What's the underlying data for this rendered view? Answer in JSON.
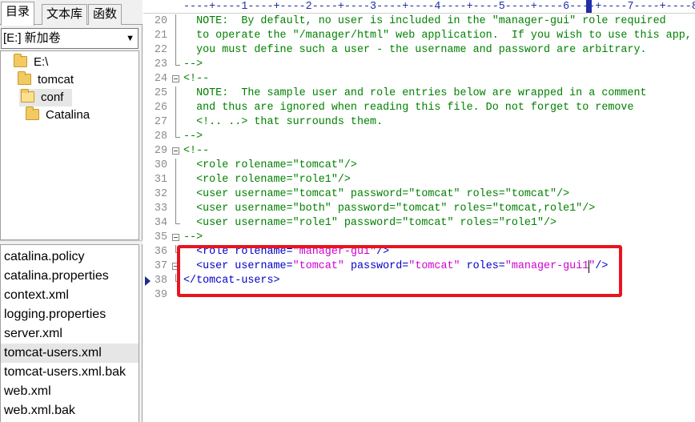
{
  "tabs": [
    "目录",
    "文本库",
    "函数"
  ],
  "drive": "[E:] 新加卷",
  "tree": [
    {
      "label": "E:\\",
      "name": "tree-node-drive-e"
    },
    {
      "label": "tomcat",
      "name": "tree-node-tomcat"
    },
    {
      "label": "conf",
      "name": "tree-node-conf",
      "selected": true
    },
    {
      "label": "Catalina",
      "name": "tree-node-catalina"
    }
  ],
  "files": [
    {
      "label": "catalina.policy"
    },
    {
      "label": "catalina.properties"
    },
    {
      "label": "context.xml"
    },
    {
      "label": "logging.properties"
    },
    {
      "label": "server.xml"
    },
    {
      "label": "tomcat-users.xml",
      "selected": true
    },
    {
      "label": "tomcat-users.xml.bak"
    },
    {
      "label": "web.xml"
    },
    {
      "label": "web.xml.bak"
    }
  ],
  "ruler": "----+----1----+----2----+----3----+----4----+----5----+----6----+----7----+----8",
  "editor": {
    "current_line": 37,
    "lines": [
      {
        "n": 20,
        "parts": [
          [
            "cm",
            "  NOTE:  By default, no user is included in the \"manager-gui\" role required"
          ]
        ]
      },
      {
        "n": 21,
        "parts": [
          [
            "cm",
            "  to operate the \"/manager/html\" web application.  If you wish to use this app,"
          ]
        ]
      },
      {
        "n": 22,
        "parts": [
          [
            "cm",
            "  you must define such a user - the username and password are arbitrary."
          ]
        ]
      },
      {
        "n": 23,
        "parts": [
          [
            "cm",
            "-->"
          ]
        ]
      },
      {
        "n": 24,
        "parts": [
          [
            "cm",
            "<!--"
          ]
        ]
      },
      {
        "n": 25,
        "parts": [
          [
            "cm",
            "  NOTE:  The sample user and role entries below are wrapped in a comment"
          ]
        ]
      },
      {
        "n": 26,
        "parts": [
          [
            "cm",
            "  and thus are ignored when reading this file. Do not forget to remove"
          ]
        ]
      },
      {
        "n": 27,
        "parts": [
          [
            "cm",
            "  <!.. ..> that surrounds them."
          ]
        ]
      },
      {
        "n": 28,
        "parts": [
          [
            "cm",
            "-->"
          ]
        ]
      },
      {
        "n": 29,
        "parts": [
          [
            "cm",
            "<!--"
          ]
        ]
      },
      {
        "n": 30,
        "parts": [
          [
            "cm",
            "  <role rolename=\"tomcat\"/>"
          ]
        ]
      },
      {
        "n": 31,
        "parts": [
          [
            "cm",
            "  <role rolename=\"role1\"/>"
          ]
        ]
      },
      {
        "n": 32,
        "parts": [
          [
            "cm",
            "  <user username=\"tomcat\" password=\"tomcat\" roles=\"tomcat\"/>"
          ]
        ]
      },
      {
        "n": 33,
        "parts": [
          [
            "cm",
            "  <user username=\"both\" password=\"tomcat\" roles=\"tomcat,role1\"/>"
          ]
        ]
      },
      {
        "n": 34,
        "parts": [
          [
            "cm",
            "  <user username=\"role1\" password=\"tomcat\" roles=\"role1\"/>"
          ]
        ]
      },
      {
        "n": 35,
        "parts": [
          [
            "cm",
            "-->"
          ]
        ]
      },
      {
        "n": 36,
        "parts": [
          [
            "tg",
            "  <role "
          ],
          [
            "at",
            "rolename="
          ],
          [
            "vl",
            "\"manager-gui\""
          ],
          [
            "tg",
            "/>"
          ]
        ]
      },
      {
        "n": 37,
        "parts": [
          [
            "tg",
            "  <user "
          ],
          [
            "at",
            "username="
          ],
          [
            "vl",
            "\"tomcat\""
          ],
          [
            "at",
            " password="
          ],
          [
            "vl",
            "\"tomcat\""
          ],
          [
            "at",
            " roles="
          ],
          [
            "vl",
            "\"manager-gui1\""
          ],
          [
            "tg",
            "/>"
          ]
        ]
      },
      {
        "n": 38,
        "parts": [
          [
            "tg",
            "</tomcat-users>"
          ]
        ]
      },
      {
        "n": 39,
        "parts": [
          [
            "cm",
            ""
          ]
        ]
      }
    ]
  },
  "colors": {
    "comment": "#008000",
    "tag": "#0000c8",
    "value": "#d000d0",
    "highlight": "#e8141e"
  },
  "icons": {
    "folder": "folder-icon",
    "fold": "fold-toggle-icon",
    "current_line": "current-line-marker-icon",
    "dropdown": "chevron-down-icon"
  }
}
